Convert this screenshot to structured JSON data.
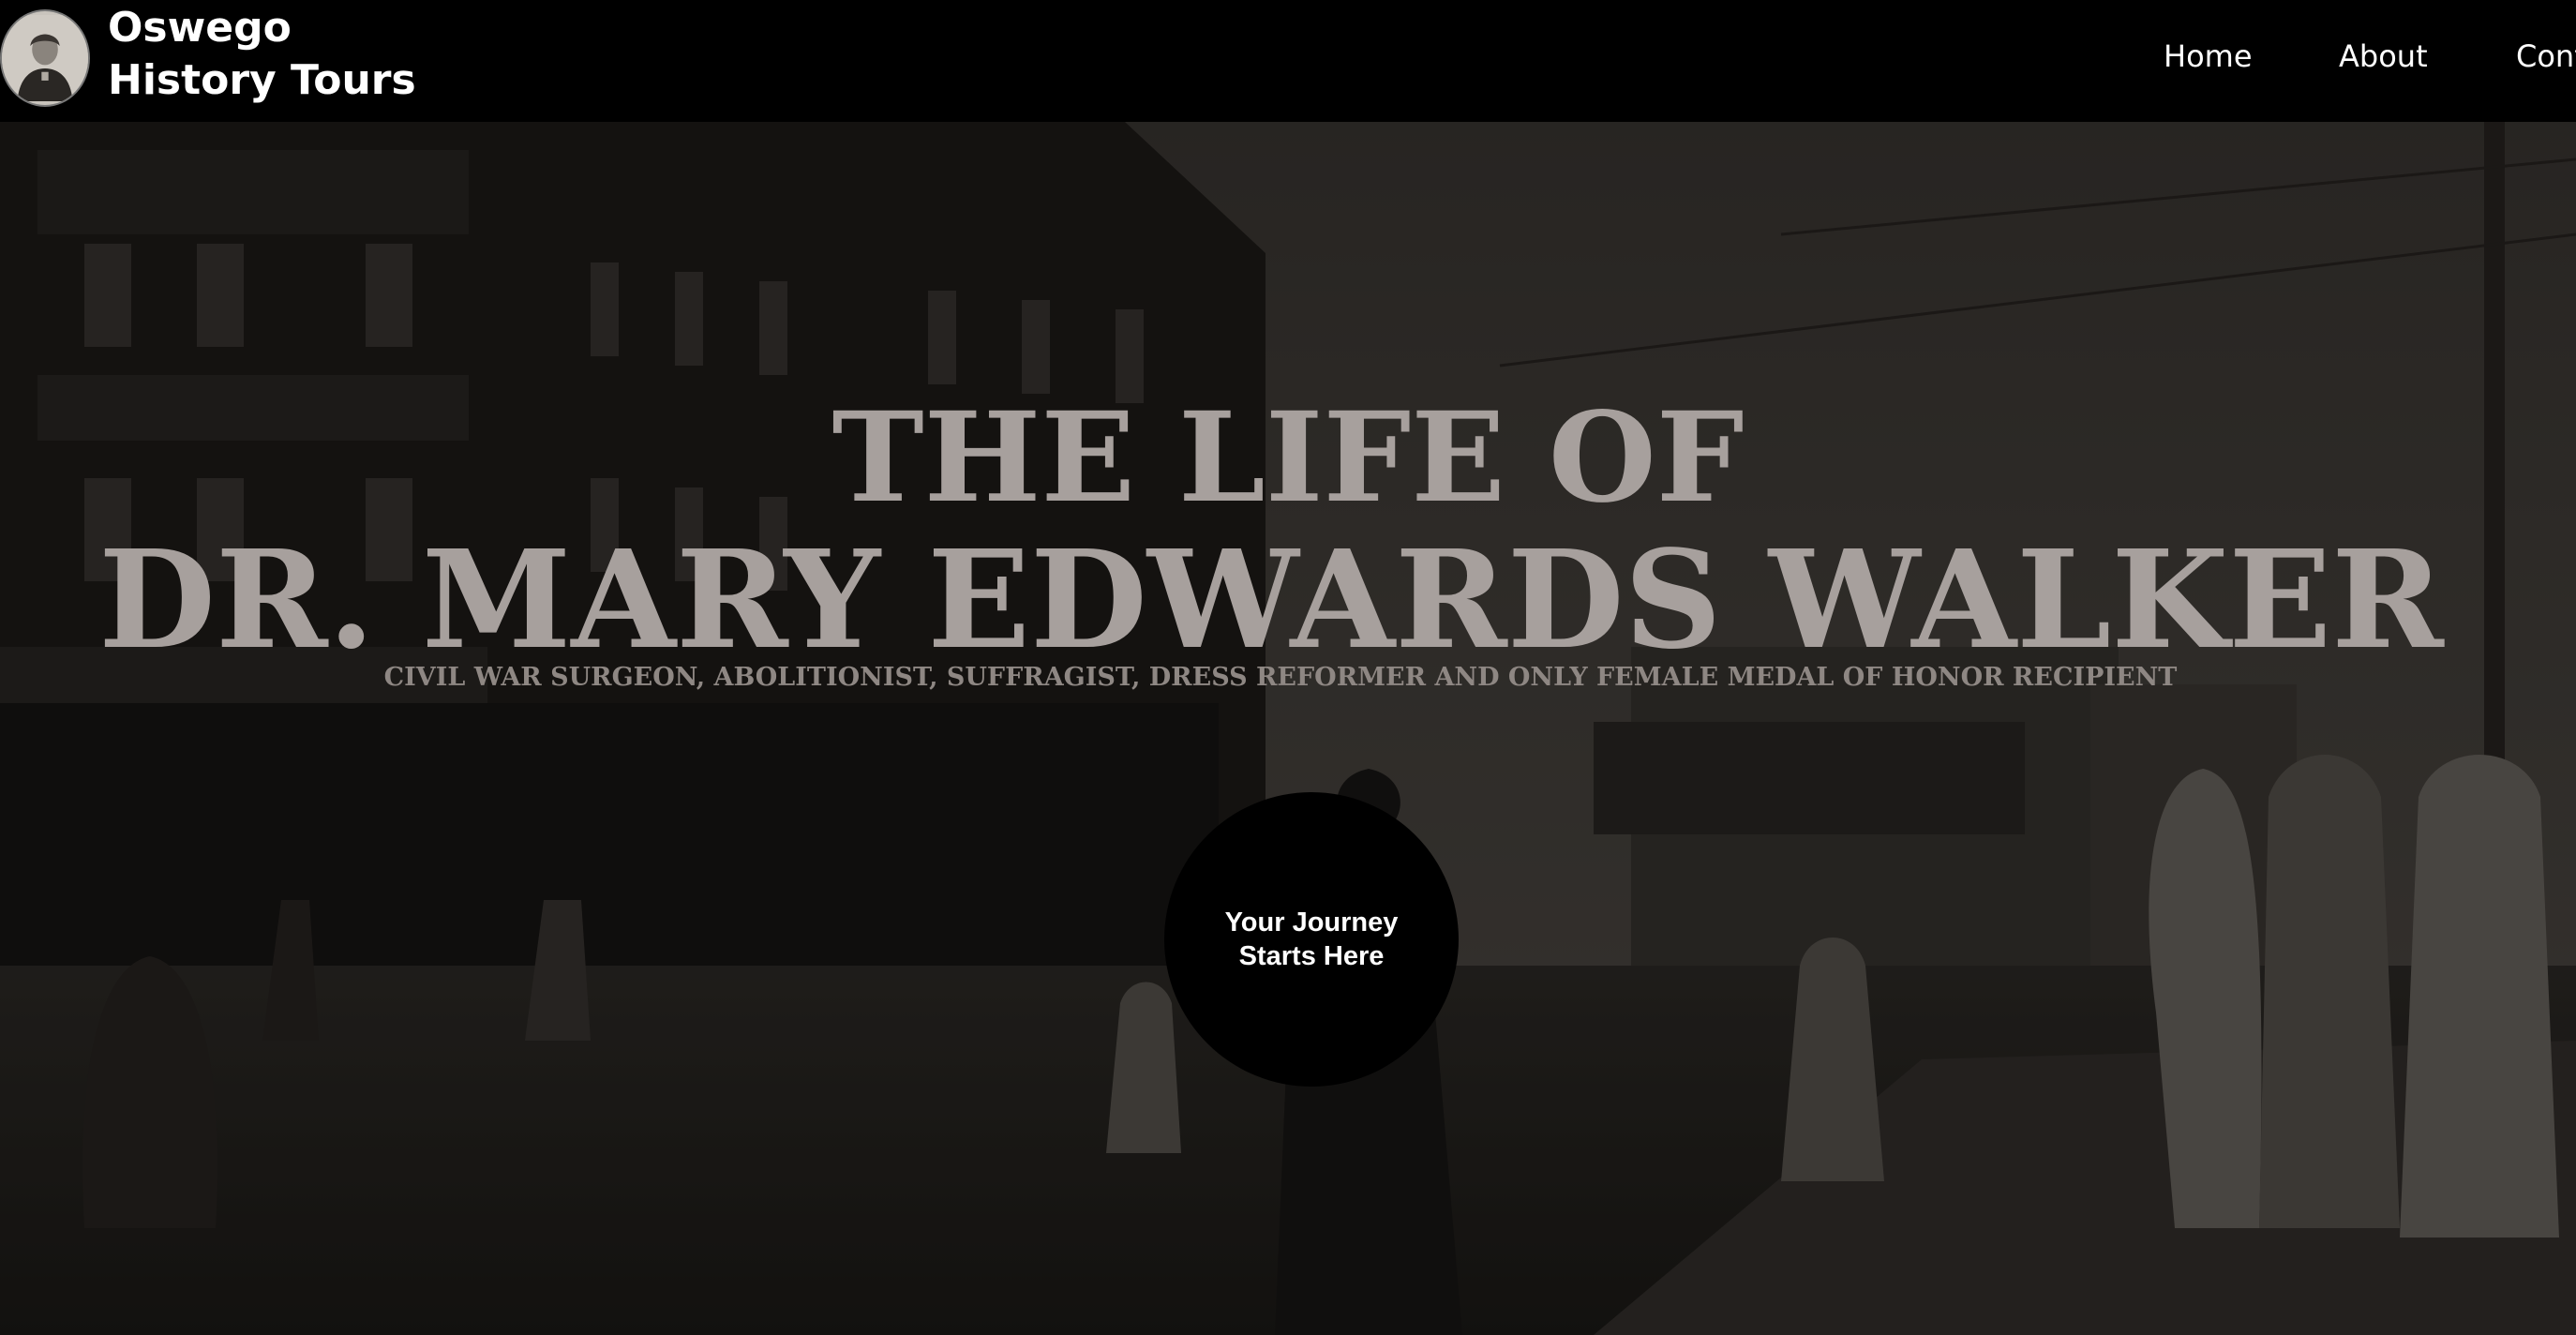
{
  "header": {
    "site_title_line1": "Oswego",
    "site_title_line2": "History Tours",
    "logo_icon": "portrait-avatar-icon",
    "nav": {
      "home": "Home",
      "about": "About",
      "contact": "Contact"
    }
  },
  "hero": {
    "title_line1": "THE LIFE OF",
    "title_line2": "DR. MARY EDWARDS WALKER",
    "subtitle": "CIVIL WAR SURGEON, ABOLITIONIST, SUFFRAGIST, DRESS REFORMER AND ONLY FEMALE MEDAL OF HONOR RECIPIENT",
    "cta_label": "Your Journey Starts Here"
  },
  "colors": {
    "header_bg": "#000000",
    "title_text": "#a7a09d",
    "subtitle_text": "#8e8783",
    "cta_bg": "#000000",
    "cta_text": "#ffffff"
  }
}
